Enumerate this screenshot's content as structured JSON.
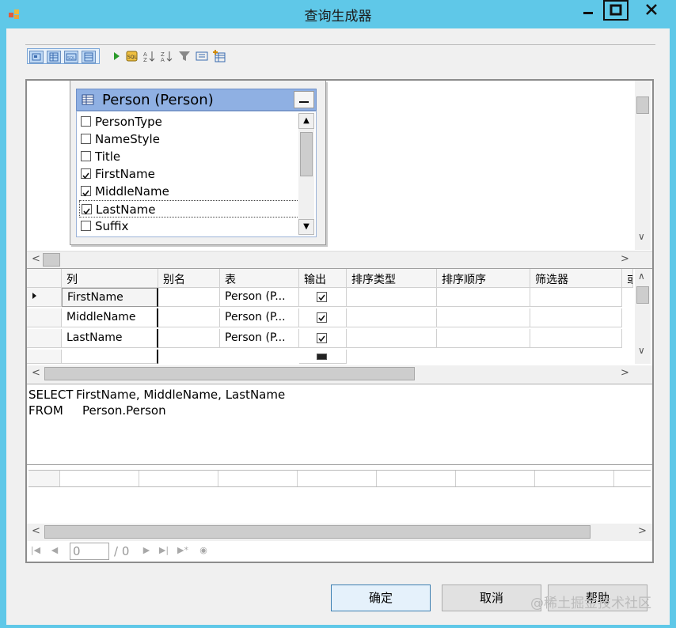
{
  "window": {
    "title": "查询生成器"
  },
  "table_box": {
    "title": "Person (Person)",
    "columns": [
      {
        "name": "PersonType",
        "checked": false
      },
      {
        "name": "NameStyle",
        "checked": false
      },
      {
        "name": "Title",
        "checked": false
      },
      {
        "name": "FirstName",
        "checked": true
      },
      {
        "name": "MiddleName",
        "checked": true
      },
      {
        "name": "LastName",
        "checked": true
      },
      {
        "name": "Suffix",
        "checked": false
      }
    ]
  },
  "grid": {
    "headers": [
      "列",
      "别名",
      "表",
      "输出",
      "排序类型",
      "排序顺序",
      "筛选器",
      "或"
    ],
    "rows": [
      {
        "column": "FirstName",
        "alias": "",
        "table": "Person (P...",
        "output": true
      },
      {
        "column": "MiddleName",
        "alias": "",
        "table": "Person (P...",
        "output": true
      },
      {
        "column": "LastName",
        "alias": "",
        "table": "Person (P...",
        "output": true
      }
    ]
  },
  "sql": {
    "line1_keyword": "SELECT",
    "line1_rest": "FirstName, MiddleName, LastName",
    "line2_keyword": "FROM",
    "line2_rest": "Person.Person"
  },
  "navigator": {
    "position": "0",
    "total": "/ 0"
  },
  "buttons": {
    "ok": "确定",
    "cancel": "取消",
    "help": "帮助"
  },
  "watermark": "@稀土掘金技术社区",
  "colors": {
    "titlebar": "#5fc8e8",
    "table_header": "#8fb0e3"
  }
}
